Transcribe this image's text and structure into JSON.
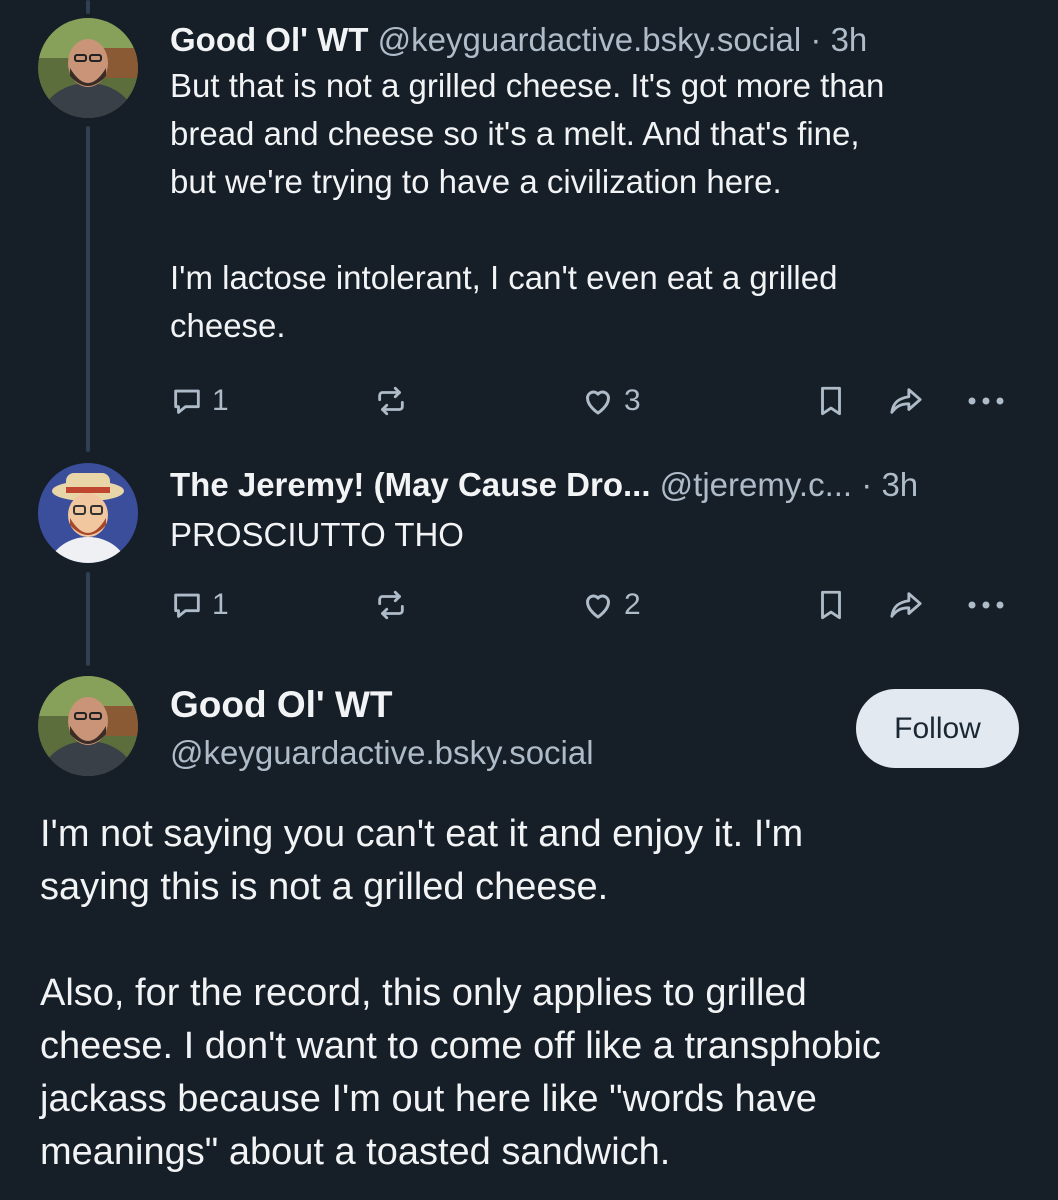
{
  "posts": [
    {
      "author": "Good Ol' WT",
      "handle": "@keyguardactive.bsky.social",
      "separator": "·",
      "time": "3h",
      "text": "But that is not a grilled cheese. It's got more than\nbread and cheese so it's a melt. And that's fine,\nbut we're trying to have a civilization here.\n\nI'm lactose intolerant, I can't even eat a grilled\ncheese.",
      "reply_count": "1",
      "like_count": "3"
    },
    {
      "author": "The Jeremy! (May Cause Dro...",
      "handle": "@tjeremy.c...",
      "separator": "·",
      "time": "3h",
      "text": "PROSCIUTTO THO",
      "reply_count": "1",
      "like_count": "2"
    }
  ],
  "focus_post": {
    "author": "Good Ol' WT",
    "handle": "@keyguardactive.bsky.social",
    "follow_label": "Follow",
    "text": "I'm not saying you can't eat it and enjoy it. I'm\nsaying this is not a grilled cheese.\n\nAlso, for the record, this only applies to grilled\ncheese. I don't want to come off like a transphobic\njackass because I'm out here like \"words have\nmeanings\" about a toasted sandwich."
  },
  "icons": {
    "reply": "reply-icon",
    "repost": "repost-icon",
    "like": "heart-icon",
    "bookmark": "bookmark-icon",
    "share": "share-icon",
    "more": "more-icon"
  },
  "colors": {
    "background": "#161e27",
    "text": "#f1f3f5",
    "muted": "#aebbc9",
    "thread_line": "#2e4052",
    "follow_button": "#e3e9f0"
  }
}
